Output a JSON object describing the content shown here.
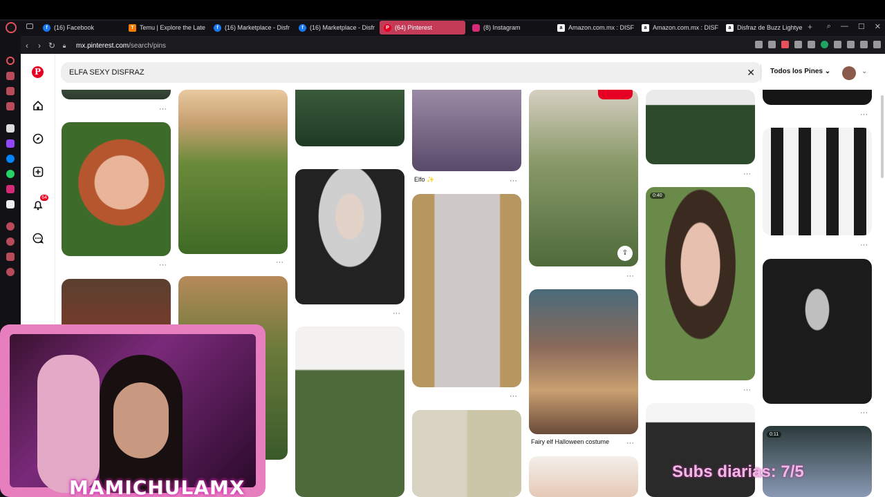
{
  "browser": {
    "tabs": [
      {
        "label": "(16) Facebook",
        "color": "#1877f2",
        "glyph": "f"
      },
      {
        "label": "Temu | Explore the Late",
        "color": "#f57c00",
        "glyph": "T"
      },
      {
        "label": "(16) Marketplace - Disfr",
        "color": "#1877f2",
        "glyph": "f"
      },
      {
        "label": "(16) Marketplace - Disfr",
        "color": "#1877f2",
        "glyph": "f"
      },
      {
        "label": "(64) Pinterest",
        "color": "#e60023",
        "glyph": "P"
      },
      {
        "label": "(8) Instagram",
        "color": "#d62976",
        "glyph": "◎"
      },
      {
        "label": "Amazon.com.mx : DISF",
        "color": "#ffffff",
        "glyph": "a"
      },
      {
        "label": "Amazon.com.mx : DISF",
        "color": "#ffffff",
        "glyph": "a"
      },
      {
        "label": "Disfraz de Buzz Lightye",
        "color": "#ffffff",
        "glyph": "a"
      }
    ],
    "url_host": "mx.pinterest.com",
    "url_path": "/search/pins"
  },
  "pinterest": {
    "search_query": "ELFA SEXY DISFRAZ",
    "filter_label": "Todos los Pines",
    "notification_count": "64",
    "captions": {
      "elfo": "Elfo ✨",
      "fairy": "Fairy elf Halloween costume"
    },
    "badges": {
      "video1": "0:40",
      "video2": "0:11"
    }
  },
  "overlay": {
    "streamer_name": "MAMICHULAMX",
    "subs_text": "Subs diarias: 7/5"
  }
}
